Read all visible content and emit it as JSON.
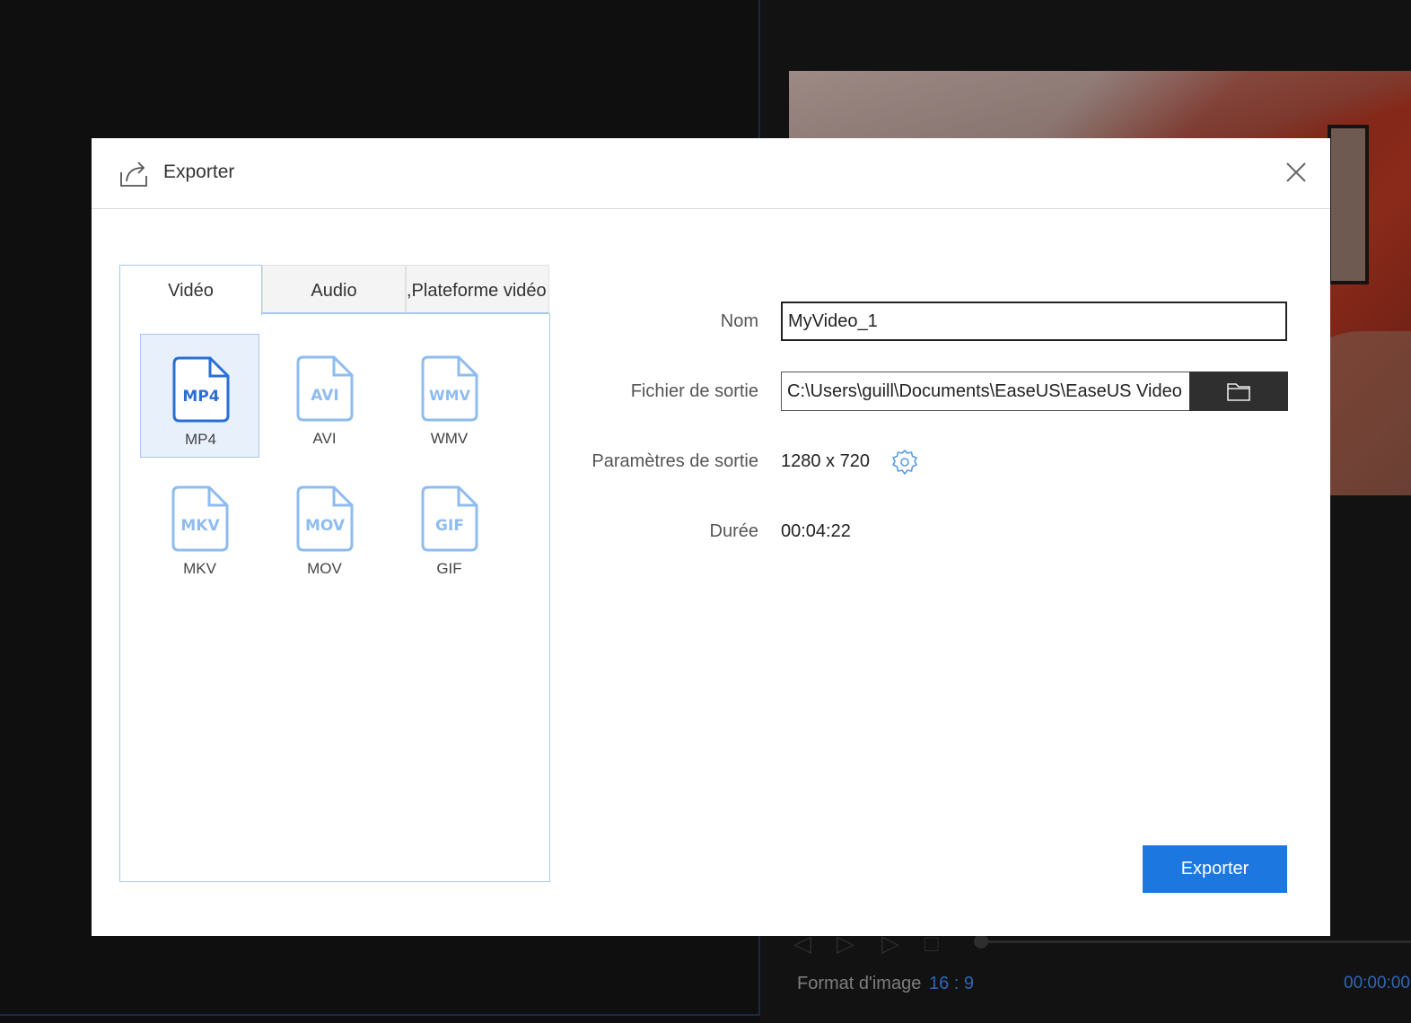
{
  "background": {
    "transport_icons": [
      "previous-icon",
      "play-icon",
      "next-icon",
      "stop-icon"
    ],
    "aspect_ratio_label": "Format d'image",
    "aspect_ratio_value": "16 : 9",
    "timecode": "00:00:00"
  },
  "dialog": {
    "title": "Exporter",
    "title_icon": "export-icon",
    "close_icon": "close-icon",
    "tabs": [
      {
        "label": "Vidéo",
        "active": true
      },
      {
        "label": "Audio",
        "active": false
      },
      {
        "label": ",Plateforme vidéo",
        "active": false
      }
    ],
    "formats": [
      {
        "label": "MP4",
        "icon_text": "MP4",
        "selected": true
      },
      {
        "label": "AVI",
        "icon_text": "AVI",
        "selected": false
      },
      {
        "label": "WMV",
        "icon_text": "WMV",
        "selected": false
      },
      {
        "label": "MKV",
        "icon_text": "MKV",
        "selected": false
      },
      {
        "label": "MOV",
        "icon_text": "MOV",
        "selected": false
      },
      {
        "label": "GIF",
        "icon_text": "GIF",
        "selected": false
      }
    ],
    "fields": {
      "name_label": "Nom",
      "name_value": "MyVideo_1",
      "output_file_label": "Fichier de sortie",
      "output_file_value": "C:\\Users\\guill\\Documents\\EaseUS\\EaseUS Video",
      "output_params_label": "Paramètres de sortie",
      "output_params_value": "1280 x 720",
      "duration_label": "Durée",
      "duration_value": "00:04:22"
    },
    "export_button": "Exporter",
    "colors": {
      "accent": "#1c78e0",
      "icon_selected": "#2a6fd6",
      "icon_unselected": "#8fbcf0",
      "tab_border": "#a8c8ec"
    }
  }
}
